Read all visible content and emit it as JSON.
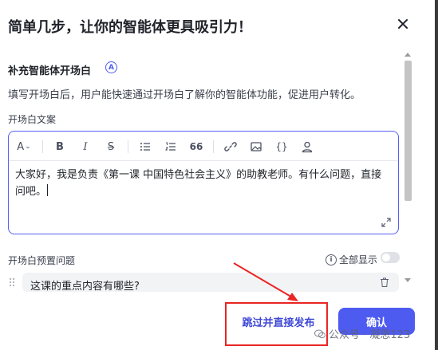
{
  "dialog": {
    "title": "简单几步，让你的智能体更具吸引力！",
    "section_title": "补充智能体开场白",
    "section_badge": "A",
    "description": "填写开场白后，用户能快速通过开场白了解你的智能体功能，促进用户转化。",
    "opening_label": "开场白文案",
    "opening_text": "大家好，我是负责《第一课 中国特色社会主义》的助教老师。有什么问题，直接问吧。",
    "toolbar": {
      "font_size": "A",
      "bold": "B",
      "italic": "I",
      "strike": "S",
      "quote": "66",
      "code": "{}"
    },
    "preset_label": "开场白预置问题",
    "show_all_label": "全部显示",
    "info_icon": "i",
    "preset_questions": [
      "这课的重点内容有哪些?"
    ],
    "toggle_on": false
  },
  "footer": {
    "skip_label": "跳过并直接发布",
    "confirm_label": "确认"
  },
  "watermark": {
    "text": "公众号 · 凝思123"
  },
  "colors": {
    "accent": "#4e5bf0",
    "annotation_red": "#ea2525"
  },
  "icons": [
    "close-icon",
    "font-size-icon",
    "bold-icon",
    "italic-icon",
    "strikethrough-icon",
    "bullet-list-icon",
    "numbered-list-icon",
    "quote-icon",
    "link-icon",
    "image-icon",
    "code-icon",
    "person-icon",
    "expand-icon",
    "info-icon",
    "drag-handle-icon",
    "trash-icon"
  ]
}
